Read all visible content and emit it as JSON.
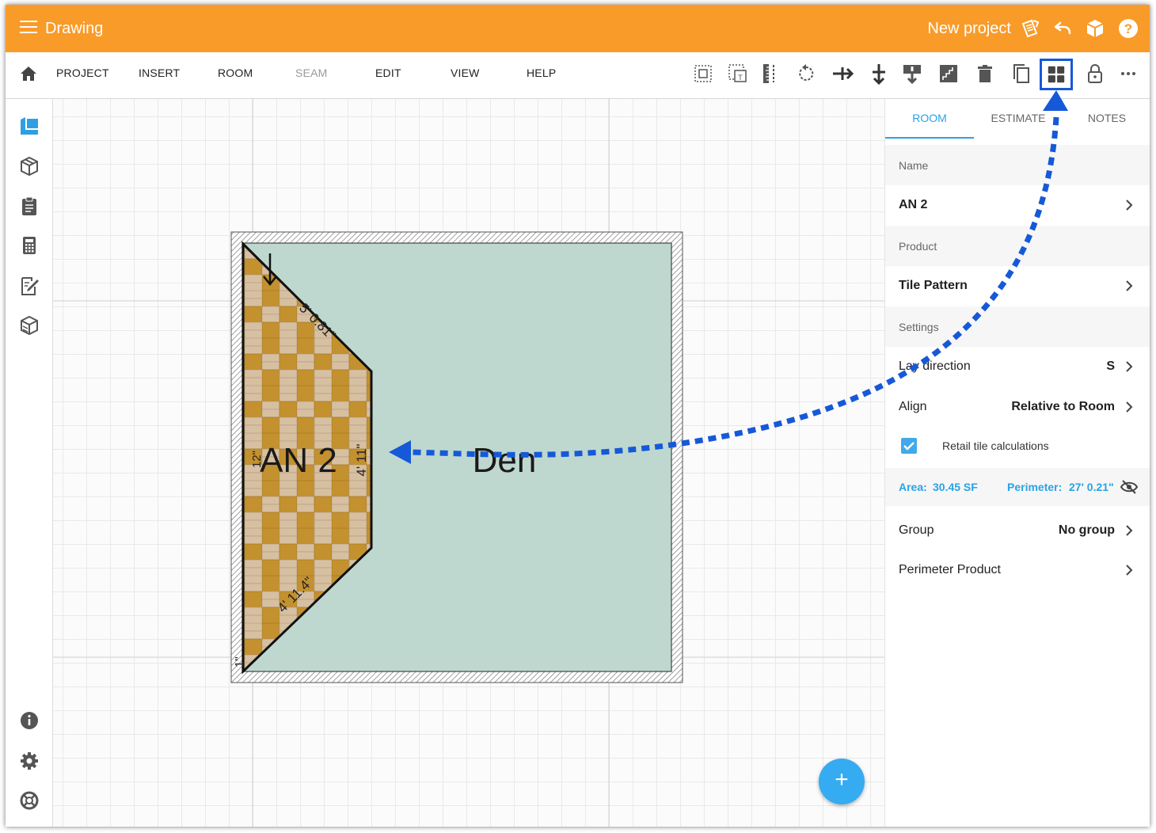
{
  "topbar": {
    "app_title": "Drawing",
    "project_name": "New project",
    "icons": [
      "menu-icon",
      "project-notes-icon",
      "undo-icon",
      "3d-view-icon",
      "help-icon"
    ]
  },
  "menubar": {
    "items": [
      {
        "label": "PROJECT",
        "enabled": true
      },
      {
        "label": "INSERT",
        "enabled": true
      },
      {
        "label": "ROOM",
        "enabled": true
      },
      {
        "label": "SEAM",
        "enabled": false
      },
      {
        "label": "EDIT",
        "enabled": true
      },
      {
        "label": "VIEW",
        "enabled": true
      },
      {
        "label": "HELP",
        "enabled": true
      }
    ],
    "toolbar_icons": [
      "select-icon",
      "select-text-icon",
      "measure-icon",
      "rotate-icon",
      "split-horizontal-icon",
      "split-vertical-icon",
      "merge-icon",
      "stairs-icon",
      "delete-icon",
      "copy-icon",
      "tile-pattern-icon",
      "lock-icon",
      "more-icon"
    ],
    "active_tool": "tile-pattern-icon"
  },
  "leftbar": {
    "icons": [
      "layers-icon",
      "3d-box-icon",
      "clipboard-icon",
      "calculator-icon",
      "notes-edit-icon",
      "products-icon"
    ],
    "bottom_icons": [
      "info-icon",
      "settings-icon",
      "support-icon"
    ]
  },
  "drawing": {
    "big_room_label": "Den",
    "small_room_label": "AN 2",
    "dimensions": [
      "5' 0.81\"",
      "4' 11\"",
      "4' 11.4\"",
      "12\"",
      "1\""
    ],
    "colors": {
      "room_fill": "#bfd8cf",
      "tile_gold": "#c4912f",
      "tile_light": "#d6c0a1",
      "arrow_blue": "#1659d8"
    }
  },
  "panel": {
    "tabs": [
      {
        "label": "ROOM",
        "active": true
      },
      {
        "label": "ESTIMATE",
        "active": false
      },
      {
        "label": "NOTES",
        "active": false
      }
    ],
    "name_section": "Name",
    "name_value": "AN 2",
    "product_section": "Product",
    "product_value": "Tile Pattern",
    "settings_section": "Settings",
    "lay_direction_label": "Lay direction",
    "lay_direction_value": "S",
    "align_label": "Align",
    "align_value": "Relative to Room",
    "retail_label": "Retail tile calculations",
    "retail_checked": true,
    "area_label": "Area:",
    "area_value": "30.45 SF",
    "perimeter_label": "Perimeter:",
    "perimeter_value": "27' 0.21\"",
    "group_label": "Group",
    "group_value": "No group",
    "perimeter_product_label": "Perimeter Product"
  },
  "fab": {
    "label": "+"
  }
}
